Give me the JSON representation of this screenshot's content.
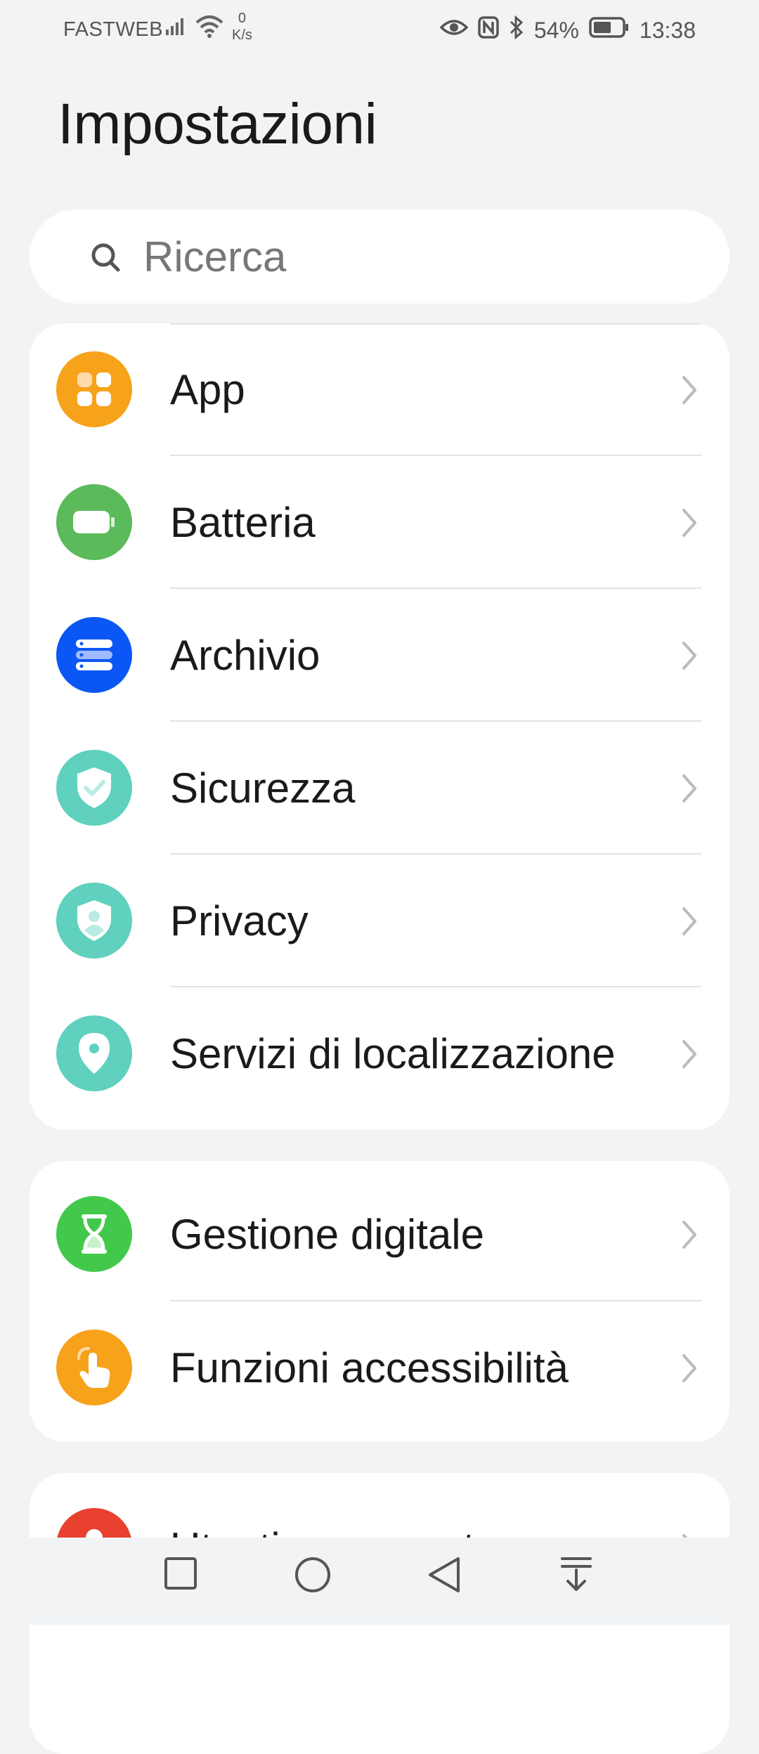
{
  "status": {
    "carrier": "FASTWEB",
    "speed_value": "0",
    "speed_unit": "K/s",
    "battery": "54%",
    "time": "13:38"
  },
  "page": {
    "title": "Impostazioni"
  },
  "search": {
    "placeholder": "Ricerca"
  },
  "group1": [
    {
      "label": "App",
      "icon": "apps-icon",
      "color": "#f7a21b"
    },
    {
      "label": "Batteria",
      "icon": "battery-icon",
      "color": "#5bba5a"
    },
    {
      "label": "Archivio",
      "icon": "storage-icon",
      "color": "#0b57f5"
    },
    {
      "label": "Sicurezza",
      "icon": "shield-check-icon",
      "color": "#5fd1be"
    },
    {
      "label": "Privacy",
      "icon": "shield-user-icon",
      "color": "#5fd1be"
    },
    {
      "label": "Servizi di localizzazione",
      "icon": "location-pin-icon",
      "color": "#5fd1be"
    }
  ],
  "group2": [
    {
      "label": "Gestione digitale",
      "icon": "hourglass-icon",
      "color": "#42c94b"
    },
    {
      "label": "Funzioni accessibilità",
      "icon": "hand-pointer-icon",
      "color": "#f7a21b"
    }
  ],
  "group3": [
    {
      "label": "Utenti e account",
      "icon": "user-icon",
      "color": "#e8412f"
    }
  ],
  "nav": [
    "recents-square-icon",
    "home-circle-icon",
    "back-triangle-icon",
    "notifications-pull-icon"
  ]
}
